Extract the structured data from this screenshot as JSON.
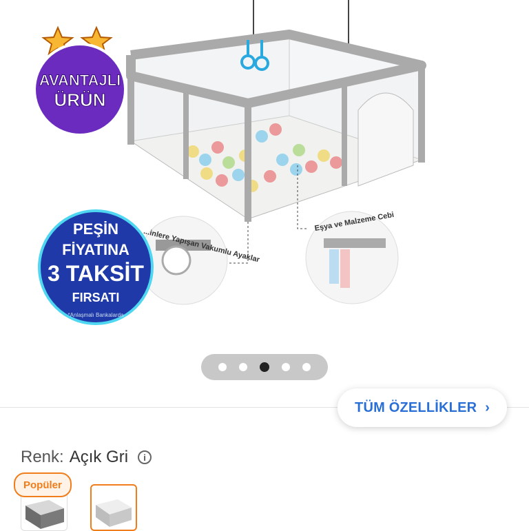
{
  "badges": {
    "avantaj": {
      "line1": "AVANTAJLI",
      "line2": "ÜRÜN"
    },
    "pesin": {
      "line1": "PEŞİN",
      "line2": "FİYATINA",
      "line3": "3 TAKSİT",
      "line4": "FIRSATI",
      "footnote": "*Anlaşmalı Bankalarda"
    }
  },
  "callouts": {
    "left": "...inlere Yapışan Vakumlu Ayaklar",
    "right": "Eşya ve Malzeme Cebi"
  },
  "pagination": {
    "count": 5,
    "active_index": 2
  },
  "features_button": {
    "label": "TÜM ÖZELLİKLER"
  },
  "color": {
    "label": "Renk:",
    "value": "Açık Gri"
  },
  "swatches": {
    "popular_label": "Popüler"
  },
  "colors": {
    "accent": "#2a6fd6",
    "popular": "#f07d1a",
    "badge_purple": "#6b2bbf"
  },
  "icons": [
    "star-icon",
    "info-icon",
    "chevron-right-icon"
  ]
}
